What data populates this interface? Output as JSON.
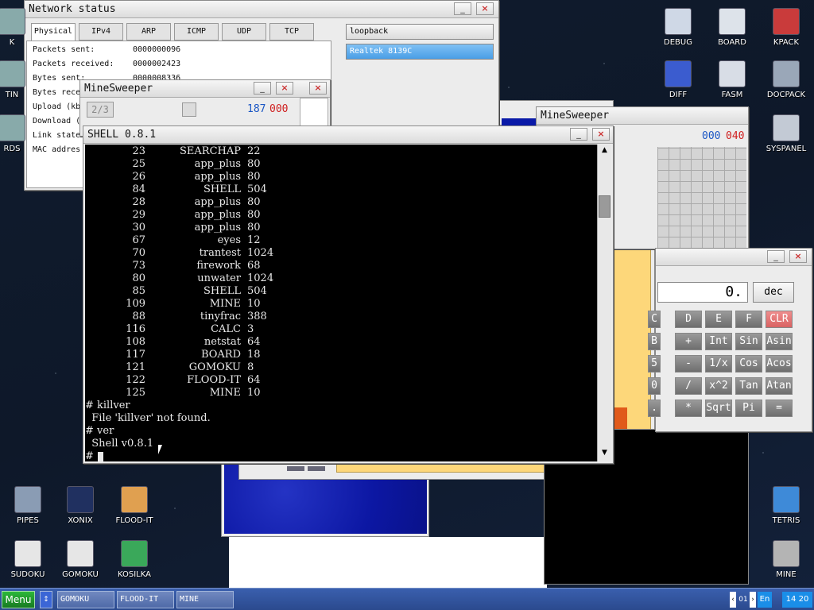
{
  "desktop_icons": [
    {
      "label": "DEBUG",
      "icon": "debug-icon"
    },
    {
      "label": "BOARD",
      "icon": "board-icon"
    },
    {
      "label": "KPACK",
      "icon": "kpack-icon"
    },
    {
      "label": "DIFF",
      "icon": "diff-icon"
    },
    {
      "label": "FASM",
      "icon": "fasm-icon"
    },
    {
      "label": "DOCPACK",
      "icon": "docpack-icon"
    },
    {
      "label": "SYSPANEL",
      "icon": "syspanel-icon"
    },
    {
      "label": "PIPES",
      "icon": "pipes-icon"
    },
    {
      "label": "XONIX",
      "icon": "xonix-icon"
    },
    {
      "label": "FLOOD-IT",
      "icon": "flood-it-icon"
    },
    {
      "label": "TETRIS",
      "icon": "tetris-icon"
    },
    {
      "label": "SUDOKU",
      "icon": "sudoku-icon"
    },
    {
      "label": "GOMOKU",
      "icon": "gomoku-icon"
    },
    {
      "label": "KOSILKA",
      "icon": "kosilka-icon"
    },
    {
      "label": "MINE",
      "icon": "mine-icon"
    },
    {
      "label": "K",
      "icon": "partial-icon"
    },
    {
      "label": "TIN",
      "icon": "partial-icon"
    },
    {
      "label": "RDS",
      "icon": "partial-icon"
    }
  ],
  "network": {
    "title": "Network status",
    "tabs": [
      "Physical",
      "IPv4",
      "ARP",
      "ICMP",
      "UDP",
      "TCP"
    ],
    "interfaces": [
      "loopback",
      "Realtek 8139C"
    ],
    "stats": [
      {
        "label": "Packets sent:",
        "value": "0000000096"
      },
      {
        "label": "Packets received:",
        "value": "0000002423"
      },
      {
        "label": "Bytes sent:",
        "value": "0000008336"
      },
      {
        "label": "Bytes rece",
        "value": ""
      },
      {
        "label": "Upload (kb",
        "value": ""
      },
      {
        "label": "Download (",
        "value": ""
      },
      {
        "label": "Link state",
        "value": ""
      },
      {
        "label": "MAC addres",
        "value": ""
      }
    ]
  },
  "mine1": {
    "title": "MineSweeper",
    "level": "2/3",
    "count_a": "187",
    "count_b": "000"
  },
  "mine2": {
    "title": "MineSweeper",
    "count_a": "000",
    "count_b": "040"
  },
  "shell": {
    "title": "SHELL 0.8.1",
    "procs": [
      {
        "id": "23",
        "name": "SEARCHAP",
        "mem": "22"
      },
      {
        "id": "25",
        "name": "app_plus",
        "mem": "80"
      },
      {
        "id": "26",
        "name": "app_plus",
        "mem": "80"
      },
      {
        "id": "84",
        "name": "SHELL",
        "mem": "504"
      },
      {
        "id": "28",
        "name": "app_plus",
        "mem": "80"
      },
      {
        "id": "29",
        "name": "app_plus",
        "mem": "80"
      },
      {
        "id": "30",
        "name": "app_plus",
        "mem": "80"
      },
      {
        "id": "67",
        "name": "eyes",
        "mem": "12"
      },
      {
        "id": "70",
        "name": "trantest",
        "mem": "1024"
      },
      {
        "id": "73",
        "name": "firework",
        "mem": "68"
      },
      {
        "id": "80",
        "name": "unwater",
        "mem": "1024"
      },
      {
        "id": "85",
        "name": "SHELL",
        "mem": "504"
      },
      {
        "id": "109",
        "name": "MINE",
        "mem": "10"
      },
      {
        "id": "88",
        "name": "tinyfrac",
        "mem": "388"
      },
      {
        "id": "116",
        "name": "CALC",
        "mem": "3"
      },
      {
        "id": "108",
        "name": "netstat",
        "mem": "64"
      },
      {
        "id": "117",
        "name": "BOARD",
        "mem": "18"
      },
      {
        "id": "121",
        "name": "GOMOKU",
        "mem": "8"
      },
      {
        "id": "122",
        "name": "FLOOD-IT",
        "mem": "64"
      },
      {
        "id": "125",
        "name": "MINE",
        "mem": "10"
      }
    ],
    "lines": [
      "# killver",
      "  File 'killver' not found.",
      "# ver",
      "  Shell v0.8.1",
      "# "
    ]
  },
  "calc": {
    "display": "0.",
    "mode": "dec",
    "buttons": [
      [
        "C",
        "D",
        "E",
        "F",
        "CLR"
      ],
      [
        "B",
        "+",
        "Int",
        "Sin",
        "Asin"
      ],
      [
        "5",
        "-",
        "1/x",
        "Cos",
        "Acos"
      ],
      [
        "0",
        "/",
        "x^2",
        "Tan",
        "Atan"
      ],
      [
        ".",
        "*",
        "Sqrt",
        "Pi",
        "="
      ]
    ]
  },
  "taskbar": {
    "menu": "Menu",
    "items": [
      "GOMOKU",
      "FLOOD-IT",
      "MINE"
    ],
    "page": "01",
    "lang": "En",
    "time": "14 20"
  },
  "colors": {
    "accent": "#4a9ee6",
    "clr": "#e06a6a",
    "menu": "#1f8a2a",
    "lcd_blue": "#1a56c4",
    "lcd_red": "#d02020"
  }
}
